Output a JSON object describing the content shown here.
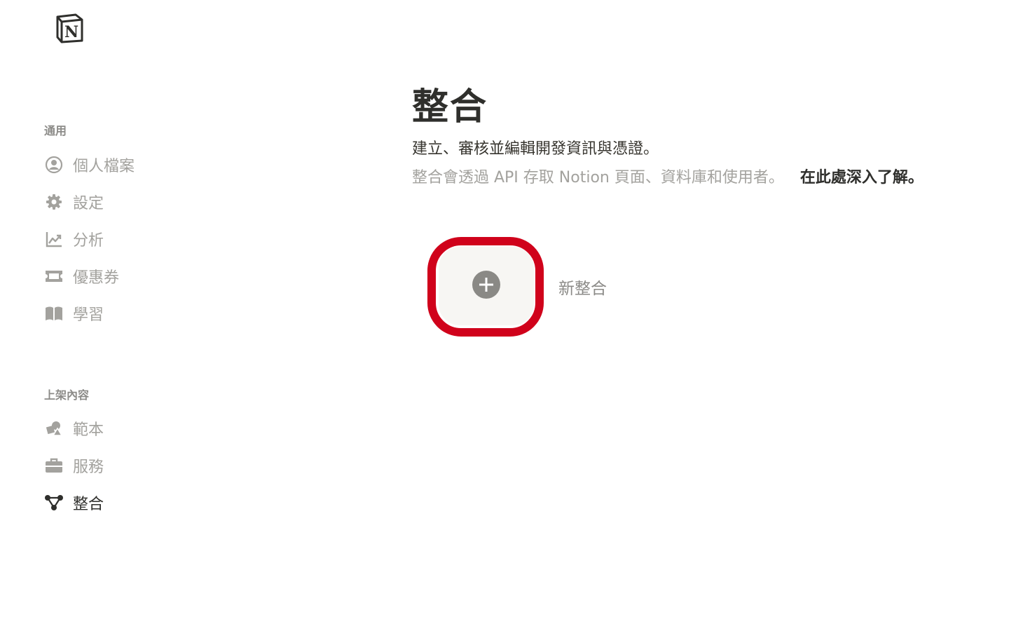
{
  "logo": {
    "icon": "notion-logo-icon"
  },
  "sidebar": {
    "sections": [
      {
        "label": "通用",
        "items": [
          {
            "label": "個人檔案",
            "icon": "user-circle-icon"
          },
          {
            "label": "設定",
            "icon": "gear-icon"
          },
          {
            "label": "分析",
            "icon": "chart-line-icon"
          },
          {
            "label": "優惠券",
            "icon": "ticket-icon"
          },
          {
            "label": "學習",
            "icon": "book-open-icon"
          }
        ]
      },
      {
        "label": "上架內容",
        "items": [
          {
            "label": "範本",
            "icon": "shapes-icon"
          },
          {
            "label": "服務",
            "icon": "briefcase-icon"
          },
          {
            "label": "整合",
            "icon": "integration-nodes-icon",
            "active": true
          }
        ]
      }
    ]
  },
  "main": {
    "title": "整合",
    "subtitle": "建立、審核並編輯開發資訊與憑證。",
    "description": "整合會透過 API 存取 Notion 頁面、資料庫和使用者。",
    "learn_more": "在此處深入了解。",
    "new_integration_label": "新整合",
    "new_integration_icon": "plus-circle-icon"
  },
  "colors": {
    "highlight": "#d0021b",
    "card_bg": "#f7f6f3",
    "muted_text": "#a3a29e"
  }
}
